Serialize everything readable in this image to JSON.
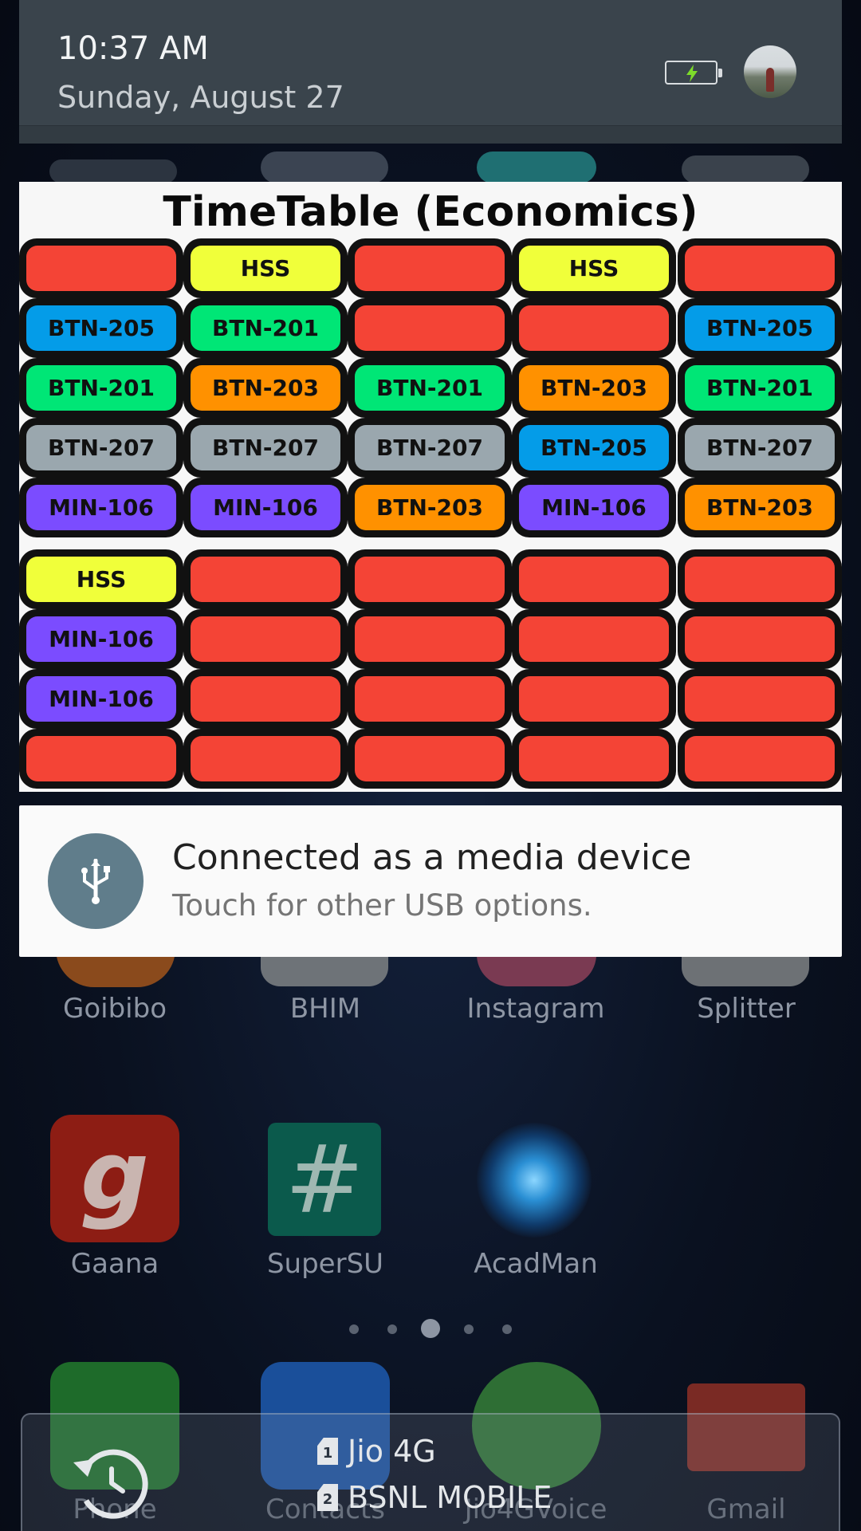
{
  "status": {
    "time": "10:37 AM",
    "date": "Sunday, August 27"
  },
  "timetable": {
    "title": "TimeTable (Economics)",
    "colors": {
      "red": "#f44436",
      "yellow": "#f0ff3a",
      "blue": "#049ce8",
      "green": "#00e676",
      "orange": "#ff9100",
      "grey": "#9aa7ae",
      "purple": "#7b4cff"
    },
    "rows": [
      [
        {
          "label": "",
          "color": "red"
        },
        {
          "label": "HSS",
          "color": "yellow"
        },
        {
          "label": "",
          "color": "red"
        },
        {
          "label": "HSS",
          "color": "yellow"
        },
        {
          "label": "",
          "color": "red"
        }
      ],
      [
        {
          "label": "BTN-205",
          "color": "blue"
        },
        {
          "label": "BTN-201",
          "color": "green"
        },
        {
          "label": "",
          "color": "red"
        },
        {
          "label": "",
          "color": "red"
        },
        {
          "label": "BTN-205",
          "color": "blue"
        }
      ],
      [
        {
          "label": "BTN-201",
          "color": "green"
        },
        {
          "label": "BTN-203",
          "color": "orange"
        },
        {
          "label": "BTN-201",
          "color": "green"
        },
        {
          "label": "BTN-203",
          "color": "orange"
        },
        {
          "label": "BTN-201",
          "color": "green"
        }
      ],
      [
        {
          "label": "BTN-207",
          "color": "grey"
        },
        {
          "label": "BTN-207",
          "color": "grey"
        },
        {
          "label": "BTN-207",
          "color": "grey"
        },
        {
          "label": "BTN-205",
          "color": "blue"
        },
        {
          "label": "BTN-207",
          "color": "grey"
        }
      ],
      [
        {
          "label": "MIN-106",
          "color": "purple"
        },
        {
          "label": "MIN-106",
          "color": "purple"
        },
        {
          "label": "BTN-203",
          "color": "orange"
        },
        {
          "label": "MIN-106",
          "color": "purple"
        },
        {
          "label": "BTN-203",
          "color": "orange"
        }
      ],
      [
        {
          "label": "HSS",
          "color": "yellow"
        },
        {
          "label": "",
          "color": "red"
        },
        {
          "label": "",
          "color": "red"
        },
        {
          "label": "",
          "color": "red"
        },
        {
          "label": "",
          "color": "red"
        }
      ],
      [
        {
          "label": "MIN-106",
          "color": "purple"
        },
        {
          "label": "",
          "color": "red"
        },
        {
          "label": "",
          "color": "red"
        },
        {
          "label": "",
          "color": "red"
        },
        {
          "label": "",
          "color": "red"
        }
      ],
      [
        {
          "label": "MIN-106",
          "color": "purple"
        },
        {
          "label": "",
          "color": "red"
        },
        {
          "label": "",
          "color": "red"
        },
        {
          "label": "",
          "color": "red"
        },
        {
          "label": "",
          "color": "red"
        }
      ],
      [
        {
          "label": "",
          "color": "red"
        },
        {
          "label": "",
          "color": "red"
        },
        {
          "label": "",
          "color": "red"
        },
        {
          "label": "",
          "color": "red"
        },
        {
          "label": "",
          "color": "red"
        }
      ]
    ]
  },
  "usb_notification": {
    "icon": "usb-icon",
    "title": "Connected as a media device",
    "text": "Touch for other USB options."
  },
  "home_apps": {
    "row1": [
      "Goibibo",
      "BHIM",
      "Instagram",
      "Splitter"
    ],
    "row2": [
      "Gaana",
      "SuperSU",
      "AcadMan"
    ],
    "dock": [
      "Phone",
      "Contacts",
      "Jio4GVoice",
      "Gmail"
    ]
  },
  "sim_panel": {
    "sim1_number": "1",
    "sim1": "Jio 4G",
    "sim2_number": "2",
    "sim2": "BSNL MOBILE"
  }
}
